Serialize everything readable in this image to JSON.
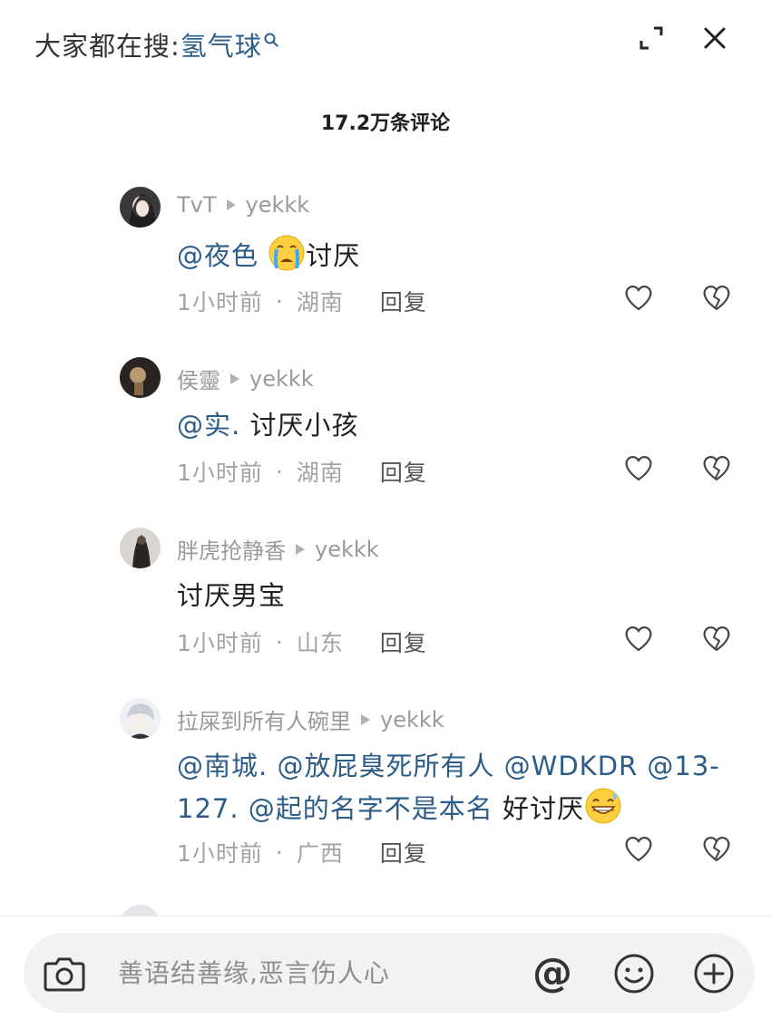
{
  "header": {
    "trending_prefix": "大家都在搜:",
    "trending_keyword": "氢气球",
    "comment_count": "17.2万条评论",
    "icons": {
      "expand": "expand-icon",
      "close": "close-icon",
      "search": "search-icon"
    }
  },
  "comments": [
    {
      "author": "TvT",
      "reply_to": "yekkk",
      "mentions": [
        "@夜色"
      ],
      "emoji": "crying-emoji",
      "text": "讨厌",
      "time": "1小时前",
      "location": "湖南",
      "reply_label": "回复"
    },
    {
      "author": "侯靈",
      "reply_to": "yekkk",
      "mentions": [
        "@实."
      ],
      "text": "讨厌小孩",
      "time": "1小时前",
      "location": "湖南",
      "reply_label": "回复"
    },
    {
      "author": "胖虎抢静香",
      "reply_to": "yekkk",
      "mentions": [],
      "text": "讨厌男宝",
      "time": "1小时前",
      "location": "山东",
      "reply_label": "回复"
    },
    {
      "author": "拉屎到所有人碗里",
      "reply_to": "yekkk",
      "mentions": [
        "@南城.",
        "@放屁臭死所有人",
        "@WDKDR",
        "@13-127.",
        "@起的名字不是本名"
      ],
      "emoji": "grinning-sweat-emoji",
      "text": "好讨厌",
      "time": "1小时前",
      "location": "广西",
      "reply_label": "回复"
    }
  ],
  "input_bar": {
    "placeholder": "善语结善缘,恶言伤人心",
    "at_label": "@",
    "icons": {
      "camera": "camera-icon",
      "at": "at-icon",
      "emoji": "emoji-icon",
      "plus": "plus-icon"
    }
  },
  "colors": {
    "mention": "#2c5d8a",
    "meta": "#a3a3a3",
    "name": "#9a9a9a",
    "input_bg": "#f2f2f4"
  }
}
